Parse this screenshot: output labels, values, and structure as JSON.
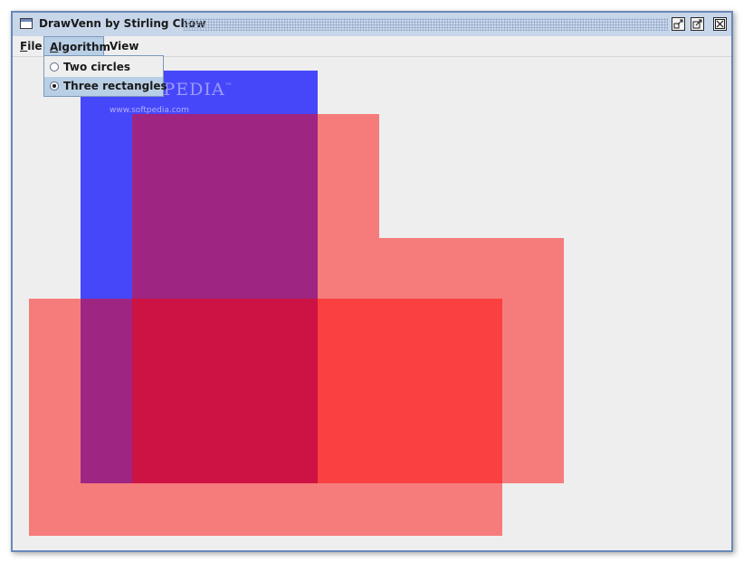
{
  "window": {
    "title": "DrawVenn by Stirling Chow",
    "controls": {
      "minimize_icon": "minimize-icon",
      "maximize_icon": "maximize-icon",
      "close_icon": "close-icon"
    }
  },
  "menubar": {
    "items": [
      {
        "mnemonic": "F",
        "rest": "ile"
      },
      {
        "mnemonic": "A",
        "rest": "lgorithm"
      },
      {
        "mnemonic": "",
        "rest": "View"
      }
    ]
  },
  "algorithm_menu": {
    "options": [
      {
        "label": "Two circles",
        "selected": false
      },
      {
        "label": "Three rectangles",
        "selected": true
      }
    ]
  },
  "watermark": {
    "brand": "SOFTPEDIA",
    "trademark": "™",
    "url": "www.softpedia.com"
  },
  "diagram": {
    "colors": {
      "set_a": "#0000ff",
      "set_b": "#ff0000",
      "set_c": "#ff0000",
      "background": "#eeeeee"
    }
  }
}
